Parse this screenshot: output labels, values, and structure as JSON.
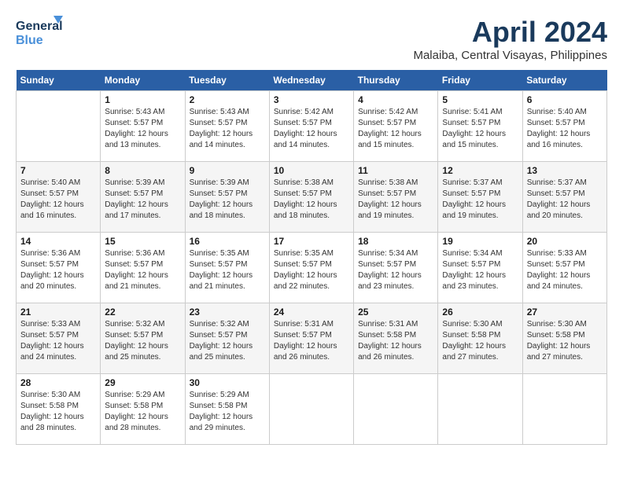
{
  "header": {
    "logo_line1": "General",
    "logo_line2": "Blue",
    "title": "April 2024",
    "subtitle": "Malaiba, Central Visayas, Philippines"
  },
  "calendar": {
    "days_of_week": [
      "Sunday",
      "Monday",
      "Tuesday",
      "Wednesday",
      "Thursday",
      "Friday",
      "Saturday"
    ],
    "weeks": [
      [
        {
          "day": "",
          "info": ""
        },
        {
          "day": "1",
          "info": "Sunrise: 5:43 AM\nSunset: 5:57 PM\nDaylight: 12 hours\nand 13 minutes."
        },
        {
          "day": "2",
          "info": "Sunrise: 5:43 AM\nSunset: 5:57 PM\nDaylight: 12 hours\nand 14 minutes."
        },
        {
          "day": "3",
          "info": "Sunrise: 5:42 AM\nSunset: 5:57 PM\nDaylight: 12 hours\nand 14 minutes."
        },
        {
          "day": "4",
          "info": "Sunrise: 5:42 AM\nSunset: 5:57 PM\nDaylight: 12 hours\nand 15 minutes."
        },
        {
          "day": "5",
          "info": "Sunrise: 5:41 AM\nSunset: 5:57 PM\nDaylight: 12 hours\nand 15 minutes."
        },
        {
          "day": "6",
          "info": "Sunrise: 5:40 AM\nSunset: 5:57 PM\nDaylight: 12 hours\nand 16 minutes."
        }
      ],
      [
        {
          "day": "7",
          "info": "Sunrise: 5:40 AM\nSunset: 5:57 PM\nDaylight: 12 hours\nand 16 minutes."
        },
        {
          "day": "8",
          "info": "Sunrise: 5:39 AM\nSunset: 5:57 PM\nDaylight: 12 hours\nand 17 minutes."
        },
        {
          "day": "9",
          "info": "Sunrise: 5:39 AM\nSunset: 5:57 PM\nDaylight: 12 hours\nand 18 minutes."
        },
        {
          "day": "10",
          "info": "Sunrise: 5:38 AM\nSunset: 5:57 PM\nDaylight: 12 hours\nand 18 minutes."
        },
        {
          "day": "11",
          "info": "Sunrise: 5:38 AM\nSunset: 5:57 PM\nDaylight: 12 hours\nand 19 minutes."
        },
        {
          "day": "12",
          "info": "Sunrise: 5:37 AM\nSunset: 5:57 PM\nDaylight: 12 hours\nand 19 minutes."
        },
        {
          "day": "13",
          "info": "Sunrise: 5:37 AM\nSunset: 5:57 PM\nDaylight: 12 hours\nand 20 minutes."
        }
      ],
      [
        {
          "day": "14",
          "info": "Sunrise: 5:36 AM\nSunset: 5:57 PM\nDaylight: 12 hours\nand 20 minutes."
        },
        {
          "day": "15",
          "info": "Sunrise: 5:36 AM\nSunset: 5:57 PM\nDaylight: 12 hours\nand 21 minutes."
        },
        {
          "day": "16",
          "info": "Sunrise: 5:35 AM\nSunset: 5:57 PM\nDaylight: 12 hours\nand 21 minutes."
        },
        {
          "day": "17",
          "info": "Sunrise: 5:35 AM\nSunset: 5:57 PM\nDaylight: 12 hours\nand 22 minutes."
        },
        {
          "day": "18",
          "info": "Sunrise: 5:34 AM\nSunset: 5:57 PM\nDaylight: 12 hours\nand 23 minutes."
        },
        {
          "day": "19",
          "info": "Sunrise: 5:34 AM\nSunset: 5:57 PM\nDaylight: 12 hours\nand 23 minutes."
        },
        {
          "day": "20",
          "info": "Sunrise: 5:33 AM\nSunset: 5:57 PM\nDaylight: 12 hours\nand 24 minutes."
        }
      ],
      [
        {
          "day": "21",
          "info": "Sunrise: 5:33 AM\nSunset: 5:57 PM\nDaylight: 12 hours\nand 24 minutes."
        },
        {
          "day": "22",
          "info": "Sunrise: 5:32 AM\nSunset: 5:57 PM\nDaylight: 12 hours\nand 25 minutes."
        },
        {
          "day": "23",
          "info": "Sunrise: 5:32 AM\nSunset: 5:57 PM\nDaylight: 12 hours\nand 25 minutes."
        },
        {
          "day": "24",
          "info": "Sunrise: 5:31 AM\nSunset: 5:57 PM\nDaylight: 12 hours\nand 26 minutes."
        },
        {
          "day": "25",
          "info": "Sunrise: 5:31 AM\nSunset: 5:58 PM\nDaylight: 12 hours\nand 26 minutes."
        },
        {
          "day": "26",
          "info": "Sunrise: 5:30 AM\nSunset: 5:58 PM\nDaylight: 12 hours\nand 27 minutes."
        },
        {
          "day": "27",
          "info": "Sunrise: 5:30 AM\nSunset: 5:58 PM\nDaylight: 12 hours\nand 27 minutes."
        }
      ],
      [
        {
          "day": "28",
          "info": "Sunrise: 5:30 AM\nSunset: 5:58 PM\nDaylight: 12 hours\nand 28 minutes."
        },
        {
          "day": "29",
          "info": "Sunrise: 5:29 AM\nSunset: 5:58 PM\nDaylight: 12 hours\nand 28 minutes."
        },
        {
          "day": "30",
          "info": "Sunrise: 5:29 AM\nSunset: 5:58 PM\nDaylight: 12 hours\nand 29 minutes."
        },
        {
          "day": "",
          "info": ""
        },
        {
          "day": "",
          "info": ""
        },
        {
          "day": "",
          "info": ""
        },
        {
          "day": "",
          "info": ""
        }
      ]
    ]
  }
}
